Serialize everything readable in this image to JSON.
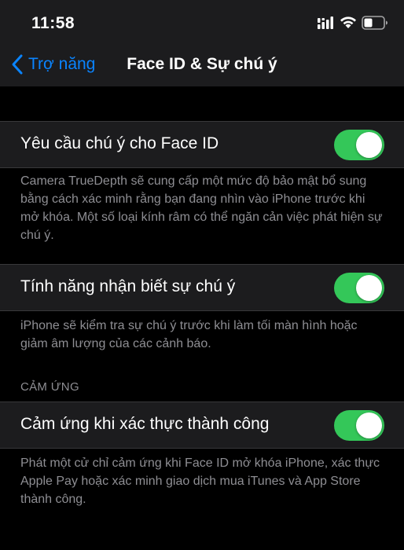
{
  "status_bar": {
    "time": "11:58",
    "icons": [
      "cellular-signal-icon",
      "wifi-icon",
      "battery-icon"
    ]
  },
  "nav": {
    "back_label": "Trợ năng",
    "title": "Face ID & Sự chú ý"
  },
  "settings": [
    {
      "label": "Yêu cầu chú ý cho Face ID",
      "enabled": true,
      "footer": "Camera TrueDepth sẽ cung cấp một mức độ bảo mật bổ sung bằng cách xác minh rằng bạn đang nhìn vào iPhone trước khi mở khóa. Một số loại kính râm có thể ngăn cản việc phát hiện sự chú ý."
    },
    {
      "label": "Tính năng nhận biết sự chú ý",
      "enabled": true,
      "footer": "iPhone sẽ kiểm tra sự chú ý trước khi làm tối màn hình hoặc giảm âm lượng của các cảnh báo."
    },
    {
      "section_header": "CẢM ỨNG",
      "label": "Cảm ứng khi xác thực thành công",
      "enabled": true,
      "footer": "Phát một cử chỉ cảm ứng khi Face ID mở khóa iPhone, xác thực Apple Pay hoặc xác minh giao dịch mua iTunes và App Store thành công."
    }
  ],
  "colors": {
    "accent": "#0a84ff",
    "toggle_on": "#34c759",
    "background": "#000000",
    "cell": "#1c1c1e",
    "secondary_text": "#8e8e93"
  }
}
